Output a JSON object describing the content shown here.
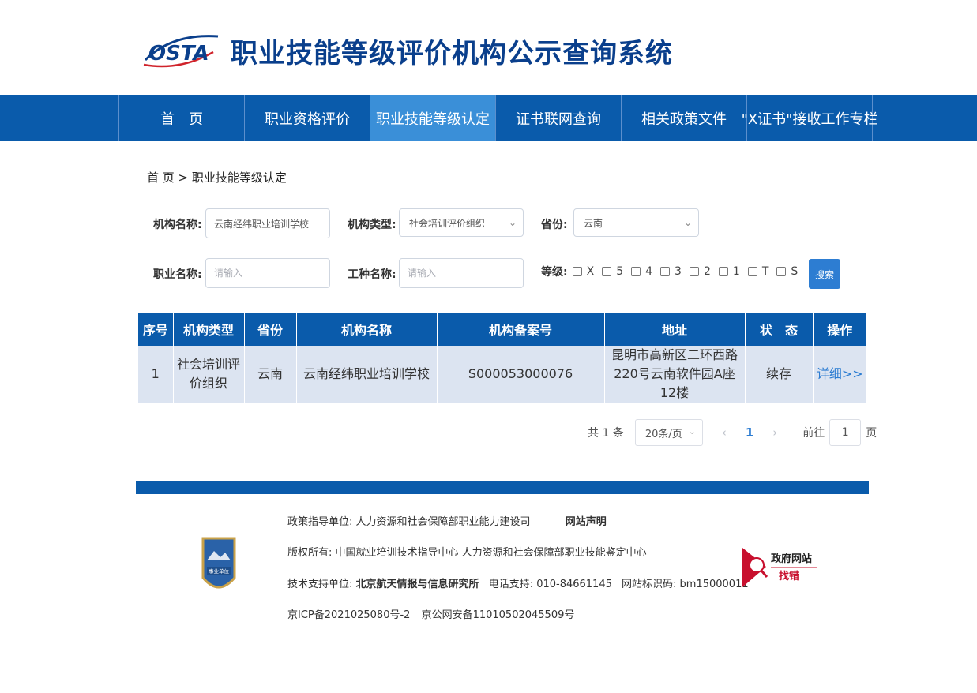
{
  "header": {
    "logo_text": "OSTA",
    "title": "职业技能等级评价机构公示查询系统"
  },
  "nav": {
    "items": [
      {
        "label": "首　页"
      },
      {
        "label": "职业资格评价"
      },
      {
        "label": "职业技能等级认定"
      },
      {
        "label": "证书联网查询"
      },
      {
        "label": "相关政策文件"
      },
      {
        "label": "\"X证书\"接收工作专栏"
      }
    ],
    "active_index": 2
  },
  "breadcrumb": "首 页 > 职业技能等级认定",
  "form": {
    "org_name_label": "机构名称:",
    "org_name_value": "云南经纬职业培训学校",
    "org_type_label": "机构类型:",
    "org_type_value": "社会培训评价组织",
    "province_label": "省份:",
    "province_value": "云南",
    "occupation_label": "职业名称:",
    "occupation_placeholder": "请输入",
    "trade_label": "工种名称:",
    "trade_placeholder": "请输入",
    "level_label": "等级:",
    "levels": [
      "X",
      "5",
      "4",
      "3",
      "2",
      "1",
      "T",
      "S"
    ],
    "search_label": "搜索"
  },
  "table": {
    "headers": [
      "序号",
      "机构类型",
      "省份",
      "机构名称",
      "机构备案号",
      "地址",
      "状　态",
      "操作"
    ],
    "rows": [
      {
        "index": "1",
        "org_type": "社会培训评价组织",
        "province": "云南",
        "org_name": "云南经纬职业培训学校",
        "record_no": "S000053000076",
        "address": "昆明市高新区二环西路220号云南软件园A座12楼",
        "status": "续存",
        "action": "详细>>"
      }
    ]
  },
  "pagination": {
    "total": "共 1 条",
    "page_size": "20条/页",
    "prev": "‹",
    "current_page": "1",
    "next": "›",
    "goto_prefix": "前往",
    "goto_value": "1",
    "goto_suffix": "页"
  },
  "footer": {
    "policy_prefix": "政策指导单位:",
    "policy_unit": "人力资源和社会保障部职业能力建设司",
    "statement": "网站声明",
    "copyright": "版权所有: 中国就业培训技术指导中心 人力资源和社会保障部职业技能鉴定中心",
    "tech_prefix": "技术支持单位:",
    "tech_unit": "北京航天情报与信息研究所",
    "phone": "电话支持: 010-84661145",
    "site_id": "网站标识码: bm15000011",
    "icp": "京ICP备2021025080号-2",
    "police": "京公网安备11010502045509号",
    "badge_left_text": "事业单位",
    "gov_badge_line1": "政府网站",
    "gov_badge_line2": "找错"
  },
  "colors": {
    "primary": "#0a5bab",
    "nav_active": "#3a8fd8",
    "title": "#0a3f8c",
    "link": "#2d7dd2",
    "row_bg": "#dce4f1"
  }
}
